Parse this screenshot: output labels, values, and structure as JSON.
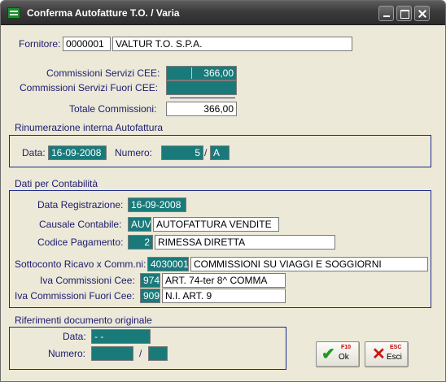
{
  "window": {
    "title": "Conferma Autofatture T.O. / Varia"
  },
  "fornitore": {
    "label": "Fornitore:",
    "code": "0000001",
    "name": "VALTUR T.O. S.P.A."
  },
  "commissioni": {
    "cee_label": "Commissioni Servizi CEE:",
    "cee_value": "366,00",
    "fuori_cee_label": "Commissioni Servizi Fuori CEE:",
    "fuori_cee_value": "",
    "totale_label": "Totale Commissioni:",
    "totale_value": "366,00"
  },
  "rinumerazione": {
    "section_title": "Rinumerazione interna Autofattura",
    "data_label": "Data:",
    "data_value": "16-09-2008",
    "numero_label": "Numero:",
    "numero_value": "5",
    "separator": "/",
    "serie_value": "A"
  },
  "contabilita": {
    "section_title": "Dati per Contabilità",
    "data_registrazione_label": "Data Registrazione:",
    "data_registrazione_value": "16-09-2008",
    "causale_label": "Causale Contabile:",
    "causale_code": "AUV",
    "causale_desc": "AUTOFATTURA VENDITE",
    "pagamento_label": "Codice Pagamento:",
    "pagamento_code": "2",
    "pagamento_desc": "RIMESSA DIRETTA",
    "sottoconto_label": "Sottoconto Ricavo x Comm.ni:",
    "sottoconto_code": "4030001",
    "sottoconto_desc": "COMMISSIONI SU VIAGGI E SOGGIORNI",
    "iva_cee_label": "Iva Commissioni Cee:",
    "iva_cee_code": "974",
    "iva_cee_desc": "ART. 74-ter 8^ COMMA",
    "iva_fuori_cee_label": "Iva Commissioni Fuori Cee:",
    "iva_fuori_cee_code": "909",
    "iva_fuori_cee_desc": "N.I. ART. 9"
  },
  "riferimenti": {
    "section_title": "Riferimenti documento originale",
    "data_label": "Data:",
    "data_value": "  -  -",
    "numero_label": "Numero:",
    "numero_value": "",
    "separator": "/",
    "serie_value": ""
  },
  "buttons": {
    "ok_key": "F10",
    "ok_label": "Ok",
    "ok_icon": "checkmark-icon",
    "esc_key": "ESC",
    "esc_label": "Esci",
    "esc_icon": "close-x-icon"
  },
  "colors": {
    "field_teal": "#1a7a7a",
    "label_navy": "#1b1a6e",
    "window_bg": "#ece9d8",
    "ok_green": "#1f9a1f",
    "esc_red": "#cc1111"
  }
}
